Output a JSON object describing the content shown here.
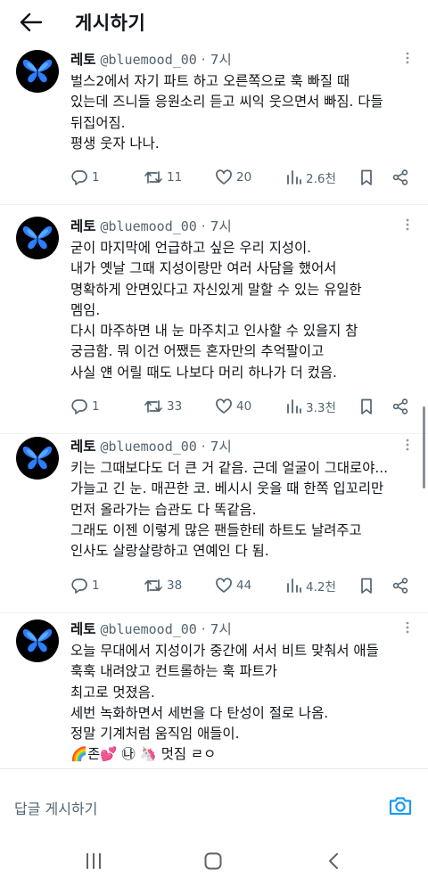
{
  "header": {
    "title": "게시하기"
  },
  "tweets": [
    {
      "name": "레토",
      "handle": "@bluemood_00",
      "time": "· 7시",
      "lines": [
        "벌스2에서 자기 파트 하고 오른쪽으로 훅 빠질 때",
        "있는데 즈니들 응원소리 듣고 씨익 웃으면서 빠짐. 다들",
        "뒤집어짐.",
        "평생 웃자 나나."
      ],
      "replies": "1",
      "retweets": "11",
      "likes": "20",
      "views": "2.6천"
    },
    {
      "name": "레토",
      "handle": "@bluemood_00",
      "time": "· 7시",
      "lines": [
        "굳이 마지막에 언급하고 싶은 우리 지성이.",
        "내가 옛날 그때 지성이랑만 여러 사담을 했어서",
        "명확하게 안면있다고 자신있게 말할 수 있는 유일한",
        "멤임.",
        "다시 마주하면 내 눈 마주치고 인사할 수 있을지 참",
        "궁금함. 뭐 이건 어쨌든 혼자만의 추억팔이고",
        "사실 얜 어릴 때도 나보다 머리 하나가 더 컸음."
      ],
      "replies": "1",
      "retweets": "33",
      "likes": "40",
      "views": "3.3천"
    },
    {
      "name": "레토",
      "handle": "@bluemood_00",
      "time": "· 7시",
      "lines": [
        "키는 그때보다도 더 큰 거 같음. 근데 얼굴이 그대로야...",
        "가늘고 긴 눈. 매끈한 코. 베시시 웃을 때 한쪽 입꼬리만",
        "먼저 올라가는 습관도 다 똑같음.",
        "그래도 이젠 이렇게 많은 팬들한테 하트도 날려주고",
        "인사도 살랑살랑하고 연예인 다 됨."
      ],
      "replies": "1",
      "retweets": "38",
      "likes": "44",
      "views": "4.2천"
    },
    {
      "name": "레토",
      "handle": "@bluemood_00",
      "time": "· 7시",
      "lines": [
        "오늘 무대에서 지성이가 중간에 서서 비트 맞춰서 애들",
        "훅훅 내려앉고 컨트롤하는 훅 파트가",
        "최고로 멋졌음.",
        "세번 녹화하면서 세번을 다 탄성이 절로 나옴.",
        "정말 기계처럼 움직임 애들이.",
        "🌈존💕 ㉯ 🦄 멋짐 ㄹㅇ"
      ],
      "replies": "",
      "retweets": "",
      "likes": "",
      "views": ""
    }
  ],
  "reply_bar": {
    "placeholder": "답글 게시하기"
  },
  "colors": {
    "accent": "#1d9bf0",
    "text": "#0f1419",
    "muted": "#536471"
  },
  "icons": {
    "back": "arrow-left-icon",
    "more": "more-vertical-icon",
    "reply": "reply-icon",
    "retweet": "retweet-icon",
    "like": "heart-icon",
    "views": "views-icon",
    "bookmark": "bookmark-icon",
    "share": "share-icon",
    "camera": "camera-icon",
    "nav_recent": "recent-apps-icon",
    "nav_home": "home-icon",
    "nav_back": "back-icon"
  }
}
